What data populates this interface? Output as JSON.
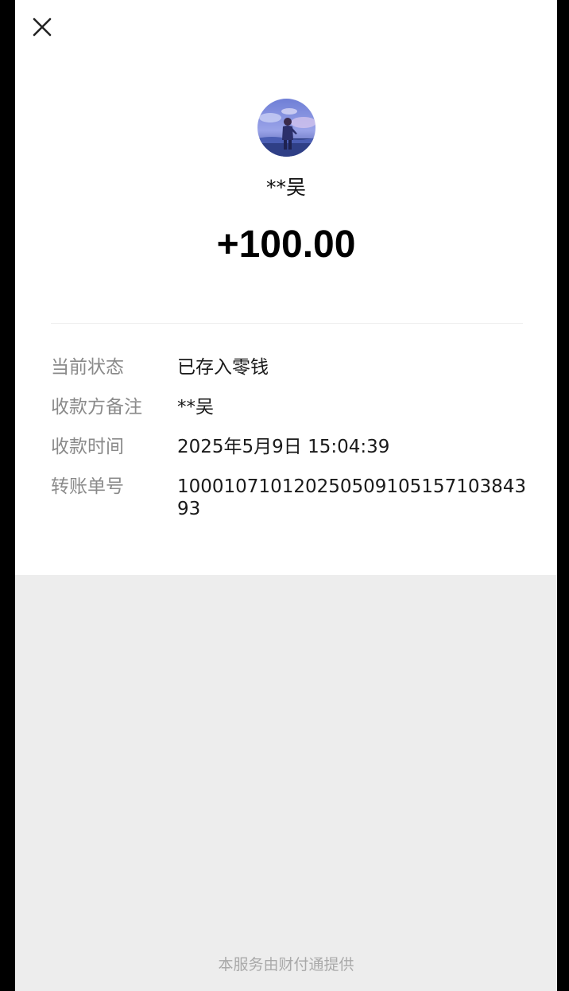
{
  "header": {
    "close_icon": "close-icon"
  },
  "payer": {
    "avatar_icon": "avatar-illustration",
    "name": "**吴"
  },
  "transfer": {
    "amount": "+100.00"
  },
  "details": [
    {
      "label": "当前状态",
      "value": "已存入零钱"
    },
    {
      "label": "收款方备注",
      "value": "**吴"
    },
    {
      "label": "收款时间",
      "value": "2025年5月9日 15:04:39"
    },
    {
      "label": "转账单号",
      "value": "100010710120250509105157103843 93"
    }
  ],
  "footer": {
    "note": "本服务由财付通提供"
  },
  "colors": {
    "background": "#ededed",
    "card": "#ffffff",
    "label_gray": "#8a8a8a",
    "footer_gray": "#a9a9a9"
  }
}
